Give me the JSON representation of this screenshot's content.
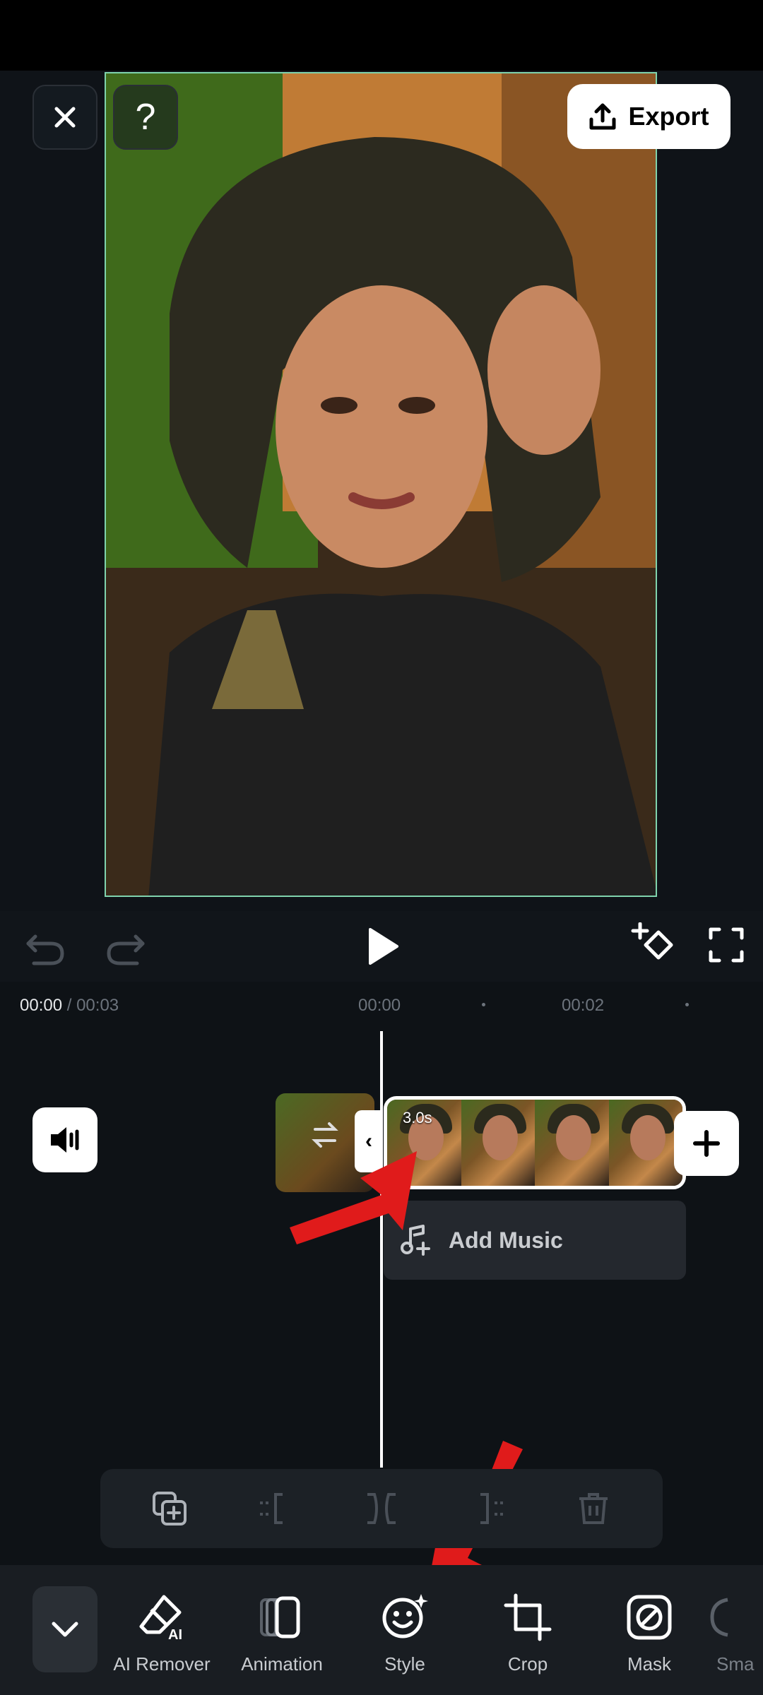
{
  "header": {
    "export_label": "Export",
    "help_glyph": "?"
  },
  "timeline": {
    "current_time": "00:00",
    "separator": " / ",
    "total_time": "00:03",
    "ruler_marks": [
      "00:00",
      "00:02"
    ]
  },
  "clip": {
    "duration": "3.0s"
  },
  "audio": {
    "add_music_label": "Add Music"
  },
  "bottom_tabs": [
    {
      "label": "AI Remover",
      "icon": "eraser-ai-icon"
    },
    {
      "label": "Animation",
      "icon": "animation-icon"
    },
    {
      "label": "Style",
      "icon": "smiley-sparkle-icon"
    },
    {
      "label": "Crop",
      "icon": "crop-icon"
    },
    {
      "label": "Mask",
      "icon": "mask-icon"
    },
    {
      "label": "Sma",
      "icon": "smart-icon"
    }
  ],
  "colors": {
    "accent_border": "#7fd3ad",
    "arrow_red": "#e01b1b"
  }
}
